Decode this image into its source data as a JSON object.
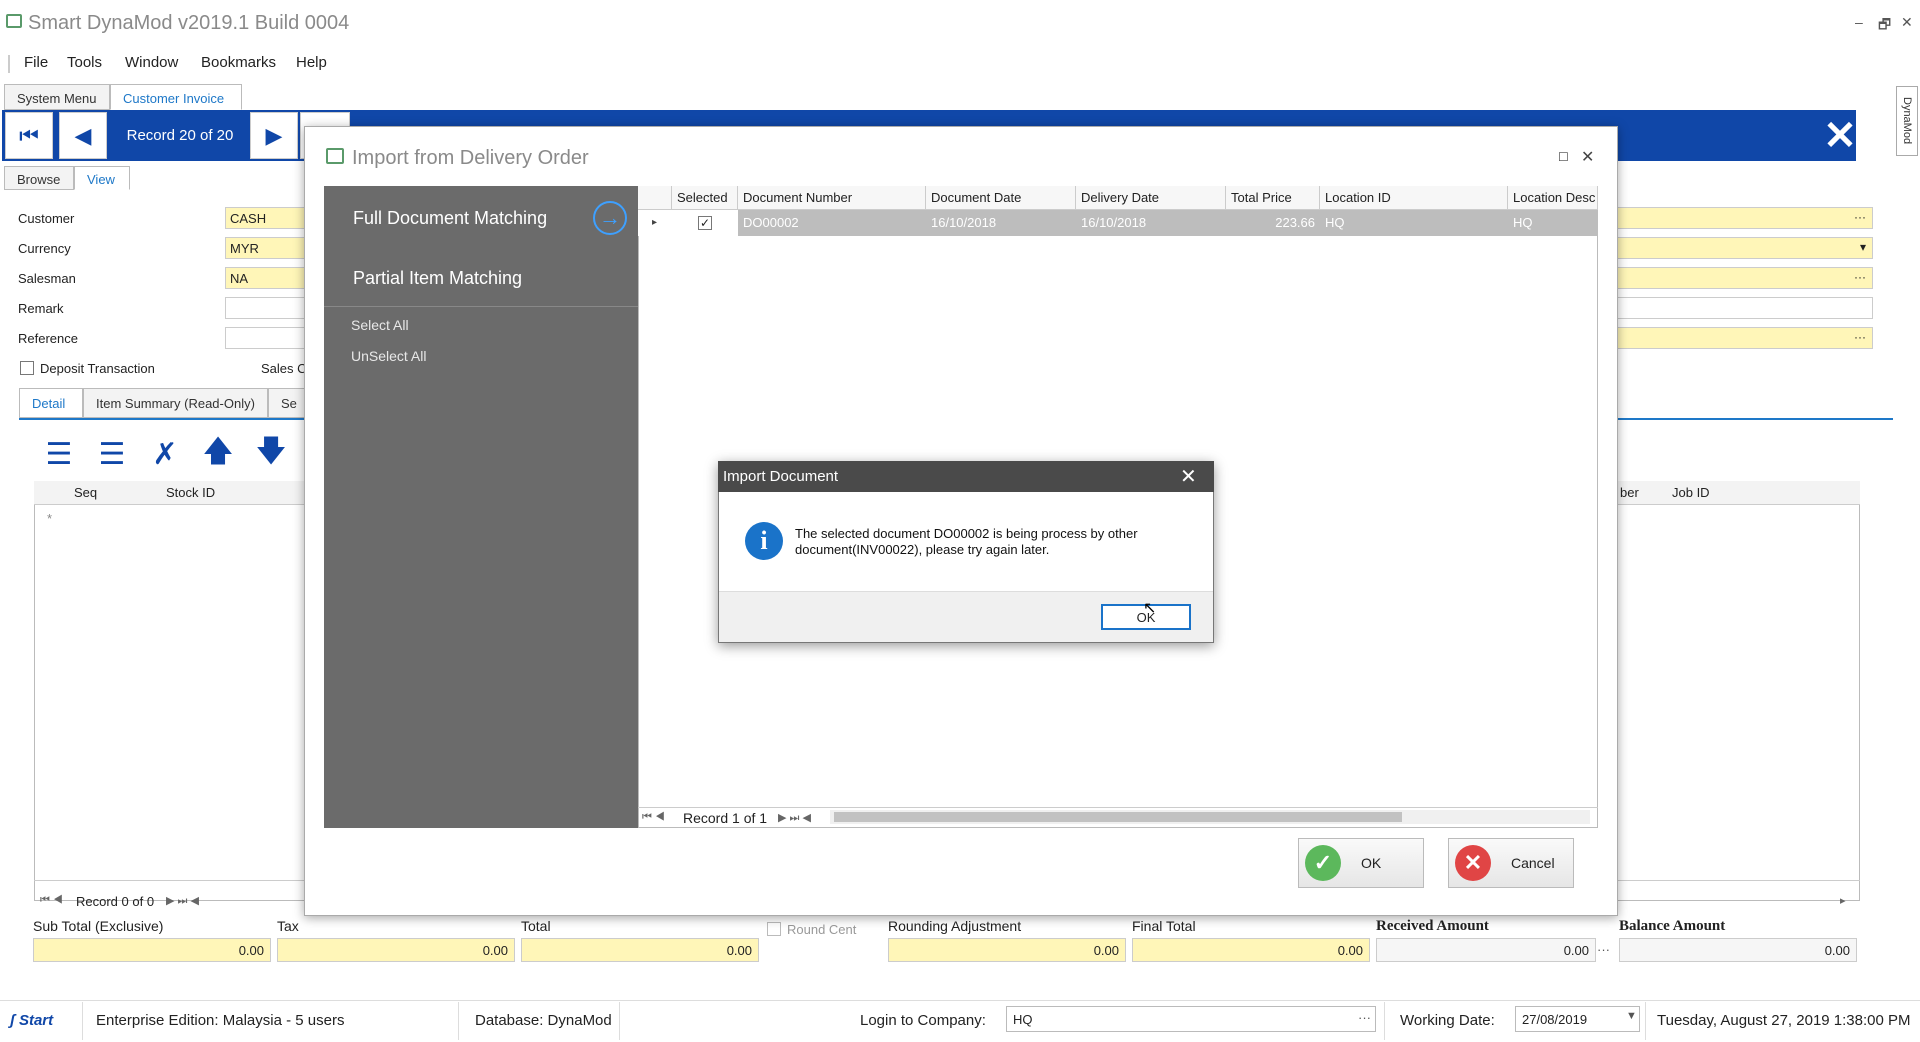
{
  "app": {
    "title": "Smart DynaMod v2019.1 Build 0004",
    "window_min": "–",
    "window_restore": "🗗",
    "window_close": "✕"
  },
  "menu": [
    "File",
    "Tools",
    "Window",
    "Bookmarks",
    "Help"
  ],
  "doc_tabs": [
    "System Menu",
    "Customer Invoice"
  ],
  "nav": {
    "record_label": "Record 20 of 20"
  },
  "side_tab": "DynaMod",
  "view_tabs": [
    "Browse",
    "View"
  ],
  "form": {
    "customer_label": "Customer",
    "customer_value": "CASH",
    "currency_label": "Currency",
    "currency_value": "MYR",
    "salesman_label": "Salesman",
    "salesman_value": "NA",
    "remark_label": "Remark",
    "reference_label": "Reference",
    "deposit_label": "Deposit Transaction",
    "sales_partial": "Sales C",
    "right_ellipsis": "···",
    "right_dropdown": "▾"
  },
  "detail_tabs": [
    "Detail",
    "Item Summary (Read-Only)",
    "Se"
  ],
  "detail_grid": {
    "col_seq": "Seq",
    "col_stock": "Stock ID",
    "col_per": "ber",
    "col_job": "Job ID",
    "new_row": "*",
    "record_label": "Record 0 of 0"
  },
  "totals": {
    "sub_total_label": "Sub Total (Exclusive)",
    "sub_total": "0.00",
    "tax_label": "Tax",
    "tax": "0.00",
    "total_label": "Total",
    "total": "0.00",
    "round_cent_label": "Round Cent",
    "rounding_label": "Rounding Adjustment",
    "rounding": "0.00",
    "final_total_label": "Final Total",
    "final_total": "0.00",
    "received_label": "Received Amount",
    "received": "0.00",
    "balance_label": "Balance Amount",
    "balance": "0.00"
  },
  "status": {
    "start": "Start",
    "edition": "Enterprise Edition: Malaysia - 5 users",
    "database": "Database: DynaMod",
    "login_label": "Login to Company:",
    "login_value": "HQ",
    "working_date_label": "Working Date:",
    "working_date": "27/08/2019",
    "datetime": "Tuesday, August 27, 2019 1:38:00 PM"
  },
  "import_dialog": {
    "title": "Import from Delivery Order",
    "full_match": "Full Document Matching",
    "partial_match": "Partial Item Matching",
    "select_all": "Select All",
    "unselect_all": "UnSelect All",
    "columns": [
      "Selected",
      "Document Number",
      "Document Date",
      "Delivery Date",
      "Total Price",
      "Location ID",
      "Location Desc"
    ],
    "row": {
      "selected": true,
      "document_number": "DO00002",
      "document_date": "16/10/2018",
      "delivery_date": "16/10/2018",
      "total_price": "223.66",
      "location_id": "HQ",
      "location_desc": "HQ"
    },
    "record_label": "Record 1 of 1",
    "ok_label": "OK",
    "cancel_label": "Cancel"
  },
  "message_box": {
    "title": "Import Document",
    "message": "The selected document DO00002 is being process by other document(INV00022), please try again later.",
    "ok_label": "OK"
  },
  "colors": {
    "toolbar_blue": "#1047a8",
    "field_yellow": "#fff6b8",
    "panel_grey": "#6b6b6b",
    "info_blue": "#1a73c9"
  }
}
